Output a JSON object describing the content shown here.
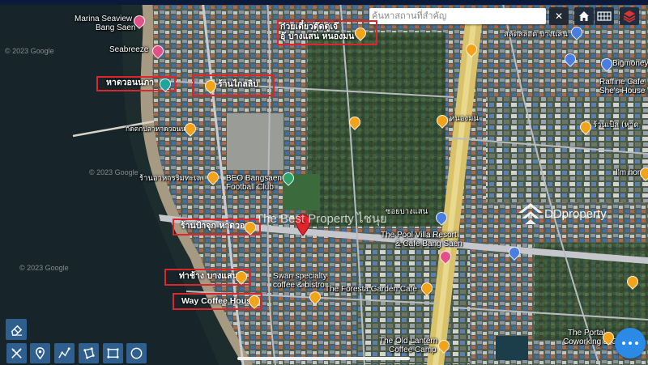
{
  "search": {
    "placeholder": "ค้นหาสถานที่สำคัญ",
    "clear_glyph": "✕"
  },
  "top_buttons": {
    "home_icon": "home-icon",
    "grid_icon": "grid-icon",
    "layers_icon": "layers-icon"
  },
  "highlighted_places": [
    {
      "name": "ก๋วยเตี๋ยวตุ๊ดตู่ เจ๊ อุ๊ บางแสน หนองมน",
      "line1": "ก๋วยเตี๋ยวตุ๊ดตู่เจ๊",
      "line2": "อุ๊ บางแสน หนองมน"
    },
    {
      "name": "หาดวอนนภา"
    },
    {
      "name": "ร้านไกลลิบ"
    },
    {
      "name": "ร้านป้าจุก หาดวอน"
    },
    {
      "name": "ท่าช้าง บางแสน"
    },
    {
      "name": "Way Coffee House"
    }
  ],
  "labels": {
    "marina": "Marina Seaview",
    "marina2": "Bang Saen",
    "seabreeze": "Seabreeze",
    "fishing_restaurant": "กัดตกปลาหาดวอนนภา",
    "rim_restaurant": "ร้านอาหารริมทะเล",
    "beo": "BEO Bangsaen",
    "beo2": "Football Club",
    "pool_villa": "The Pool Villa Resort",
    "pool_villa2": "& Cafe Bang Saen",
    "swan": "Swan specialty",
    "swan2": "coffee & bistro",
    "foresta": "The Foresta Garden Cafe",
    "old_lantern": "The Old Lantern",
    "old_lantern2": "Coffee Camp",
    "portal": "The Portal",
    "portal2": "Coworking & Coffee",
    "raffine": "Raffine Cafe",
    "raffine2": "She's House W",
    "bigmoney": "Bigmoney",
    "in_home": "I'm home",
    "raan_pen": "ร้านเป็ล (หาด",
    "salad": "สลัดสลอด บางแสน",
    "nong_mon": "หนองมน",
    "soi": "ซอยบางแสน"
  },
  "watermark": "The Best Property ไชนุย",
  "brand": "DDproperty",
  "copyright": "© 2023 Google",
  "tools": [
    "eraser-icon",
    "ruler-icon",
    "location-pin-icon",
    "route-icon",
    "polygon-icon",
    "rectangle-icon",
    "circle-icon"
  ]
}
